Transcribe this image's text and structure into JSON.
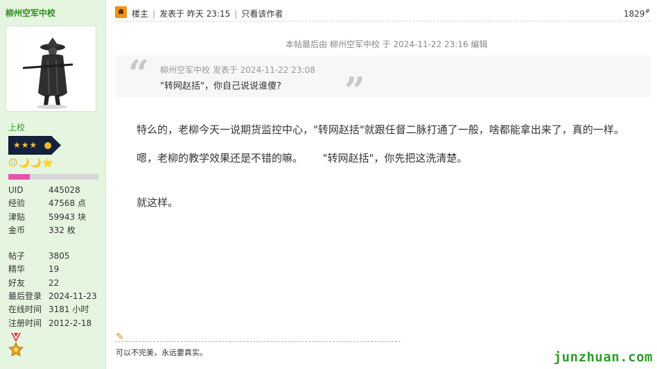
{
  "user": {
    "name": "柳州空军中校",
    "rank": "上校",
    "emoji_icons": "😐🌙🌙⭐",
    "level_progress": 0.24,
    "stats_group1": [
      {
        "label": "UID",
        "value": "445028"
      },
      {
        "label": "经验",
        "value": "47568 点"
      },
      {
        "label": "津贴",
        "value": "59943 块"
      },
      {
        "label": "金币",
        "value": "332 枚"
      }
    ],
    "stats_group2": [
      {
        "label": "帖子",
        "value": "3805"
      },
      {
        "label": "精华",
        "value": "19"
      },
      {
        "label": "好友",
        "value": "22"
      },
      {
        "label": "最后登录",
        "value": "2024-11-23"
      },
      {
        "label": "在线时间",
        "value": "3181 小时"
      },
      {
        "label": "注册时间",
        "value": "2012-2-18"
      }
    ]
  },
  "post": {
    "owner_label": "楼主",
    "posted": "发表于 昨天 23:15",
    "only_author": "只看该作者",
    "floor": "1829",
    "floor_mark": "#",
    "edit_note": "本帖最后由 柳州空军中校 于 2024-11-22 23:16 编辑",
    "quote_meta": "柳州空军中校 发表于 2024-11-22 23:08",
    "quote_text": "\"转网赵括\"，你自己说说谁傻?",
    "paragraphs": [
      "特么的，老柳今天一说期货监控中心，\"转网赵括\"就跟任督二脉打通了一般，啥都能拿出来了，真的一样。",
      "嗯，老柳的教学效果还是不错的嘛。      \"转网赵括\"，你先把这洗清楚。",
      "就这样。"
    ],
    "signature": "可以不完美，永远要真实。"
  },
  "watermark": "junzhuan.com",
  "colors": {
    "sidebar_bg": "#e5f5df",
    "username": "#2d8f1d",
    "level_fill": "#e552ab",
    "watermark": "#2e9d2a"
  },
  "icons": {
    "owner": "owner-icon",
    "pencil": "pencil-icon",
    "medal": "medal-icon"
  }
}
